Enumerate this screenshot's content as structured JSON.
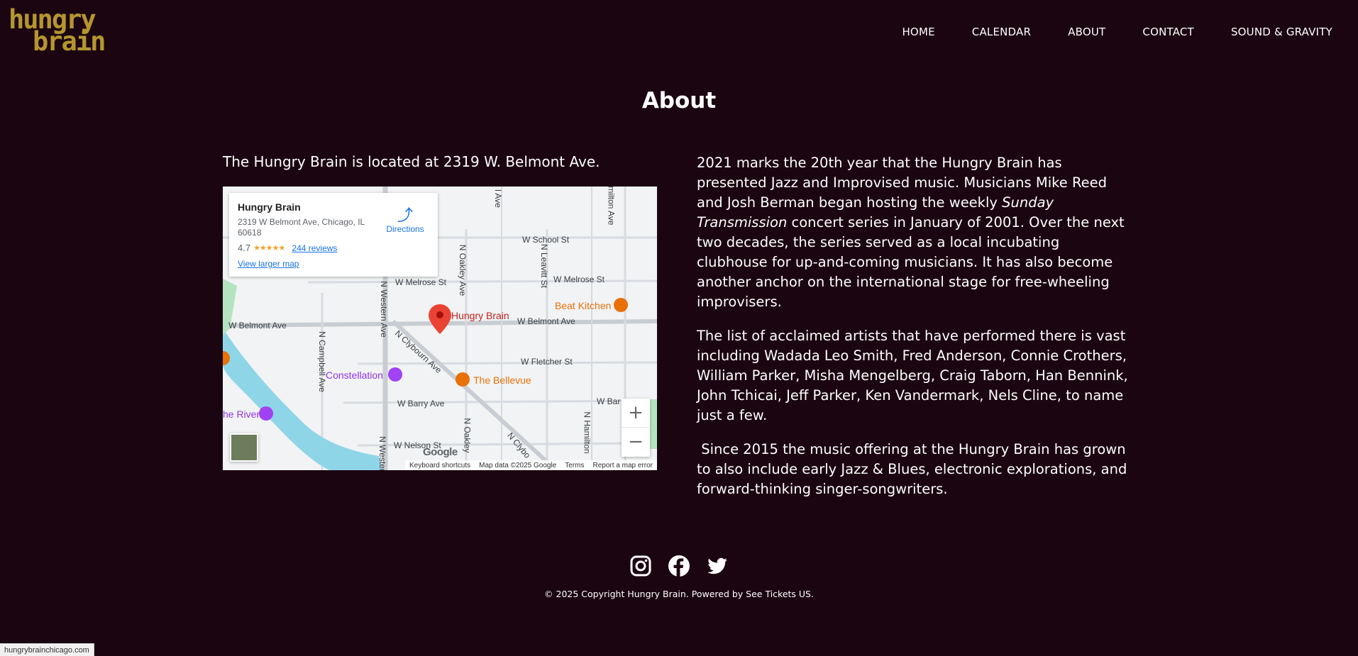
{
  "header": {
    "logo_line1": "hungry",
    "logo_line2": "brain",
    "nav": [
      "HOME",
      "CALENDAR",
      "ABOUT",
      "CONTACT",
      "SOUND & GRAVITY"
    ]
  },
  "page_title": "About",
  "location_text": "The Hungry Brain is located at 2319 W. Belmont Ave.",
  "map": {
    "place_name": "Hungry Brain",
    "address": "2319 W Belmont Ave, Chicago, IL 60618",
    "rating": "4.7",
    "stars": "★★★★★",
    "reviews": "244 reviews",
    "directions": "Directions",
    "view_larger": "View larger map",
    "marker_label": "Hungry Brain",
    "zoom_in": "+",
    "zoom_out": "−",
    "google": "Google",
    "footer": [
      "Keyboard shortcuts",
      "Map data ©2025 Google",
      "Terms",
      "Report a map error"
    ],
    "labels": {
      "school": "W School St",
      "melrose_left": "W Melrose St",
      "melrose_right": "W Melrose St",
      "belmont_left": "W Belmont Ave",
      "belmont_right": "W Belmont Ave",
      "fletcher": "W Fletcher St",
      "barry": "W Barry Ave",
      "barry_right": "W Bar",
      "nelson": "W Nelson St",
      "oakley_top": "N Oakley Ave",
      "oakley_bottom": "N Oakley",
      "leavitt": "N Leavitt St",
      "western": "N Western Ave",
      "western_bottom": "N Wester",
      "campbell": "N Campbell Ave",
      "clybourn": "N Clybourn Ave",
      "clybourn_bottom": "N Clybo",
      "hamilton_top": "milton Ave",
      "hamilton_bottom": "N Hamilton",
      "ave_top": "l Ave",
      "beat_kitchen": "Beat Kitchen",
      "bellevue": "The Bellevue",
      "constellation": "Constellation",
      "river": "he River"
    }
  },
  "about": {
    "p1_before": "2021 marks the 20th year that the Hungry Brain has presented Jazz and Improvised music. Musicians Mike Reed and Josh Berman began hosting the weekly ",
    "p1_italic": "Sunday Transmission",
    "p1_after": " concert series in January of 2001. Over the next two decades, the series served as a local incubating clubhouse for up-and-coming musicians. It has also become another anchor on the international stage for free-wheeling improvisers.",
    "p2": "The list of acclaimed artists that have performed there is vast including Wadada Leo Smith, Fred Anderson, Connie Crothers, William Parker, Misha Mengelberg, Craig Taborn, Han Bennink, John Tchicai, Jeff Parker, Ken Vandermark, Nels Cline, to name just a few.",
    "p3": " Since 2015 the music offering at the Hungry Brain has grown to also include early Jazz & Blues, electronic explorations, and forward-thinking singer-songwriters."
  },
  "social": [
    "instagram-icon",
    "facebook-icon",
    "twitter-icon"
  ],
  "copyright": "© 2025 Copyright Hungry Brain. Powered by See Tickets US.",
  "status_bar": "hungrybrainchicago.com",
  "colors": {
    "background": "#1b0510",
    "logo": "#b5962e",
    "link": "#1a73e8",
    "marker": "#ea4335"
  }
}
